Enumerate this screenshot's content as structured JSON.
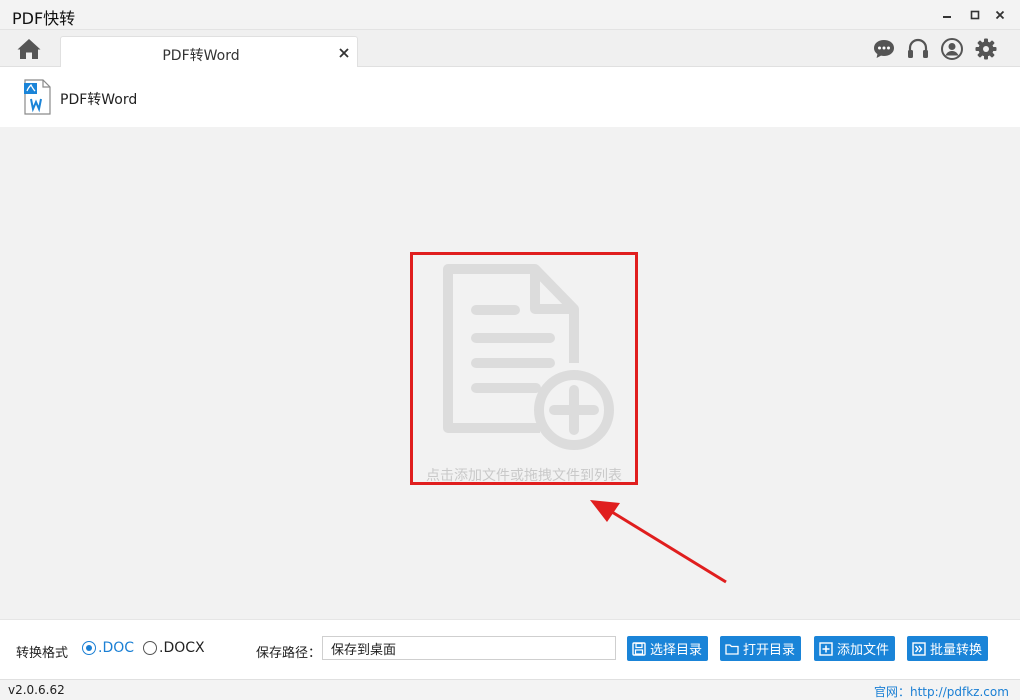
{
  "window": {
    "title": "PDF快转"
  },
  "tabs": [
    {
      "label": "PDF转Word",
      "active": true
    }
  ],
  "module": {
    "title": "PDF转Word"
  },
  "dropzone": {
    "hint": "点击添加文件或拖拽文件到列表"
  },
  "bottom": {
    "format_label": "转换格式",
    "formats": [
      {
        "label": ".DOC",
        "selected": true
      },
      {
        "label": ".DOCX",
        "selected": false
      }
    ],
    "save_label": "保存路径：",
    "save_value": "保存到桌面",
    "buttons": {
      "choose_dir": "选择目录",
      "open_dir": "打开目录",
      "add_file": "添加文件",
      "batch_convert": "批量转换"
    }
  },
  "status": {
    "version": "v2.0.6.62",
    "site": "官网：http://pdfkz.com"
  },
  "icons": {
    "home": "home-icon",
    "chat": "chat-icon",
    "support": "headset-icon",
    "account": "user-icon",
    "settings": "gear-icon"
  },
  "colors": {
    "accent": "#1a84d8",
    "highlight_box": "#e01e1e",
    "link": "#1a7fd4"
  }
}
